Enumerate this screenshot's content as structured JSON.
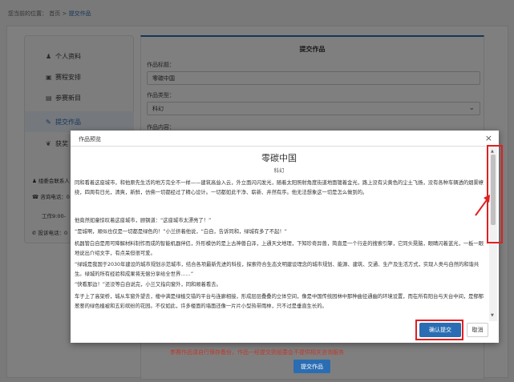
{
  "breadcrumb": {
    "prefix": "您当前的位置：",
    "home": "首页",
    "sep": ">",
    "current": "提交作品"
  },
  "sidebar": {
    "items": [
      {
        "icon": "user-icon",
        "glyph": "♟",
        "label": "个人资料"
      },
      {
        "icon": "calendar-icon",
        "glyph": "▣",
        "label": "赛程安排"
      },
      {
        "icon": "document-icon",
        "glyph": "▤",
        "label": "参赛新目"
      },
      {
        "icon": "edit-icon",
        "glyph": "✎",
        "label": "提交作品"
      },
      {
        "icon": "trophy-icon",
        "glyph": "❦",
        "label": "获奖"
      }
    ],
    "contact": [
      {
        "glyph": "♟",
        "text": "组委会联系人"
      },
      {
        "glyph": "☎",
        "text": "咨询电话：0"
      },
      {
        "glyph": "",
        "text": "工作9:00-"
      },
      {
        "glyph": "✆",
        "text": "投诉电话：0"
      }
    ]
  },
  "form": {
    "title": "提交作品",
    "work_title_label": "作品标题：",
    "work_title_value": "零碳中国",
    "work_type_label": "作品类型：",
    "work_type_value": "科幻",
    "work_content_label": "作品内容："
  },
  "notice": "参赛作品请自行保存备份，作品一经提交则组委会不提供相关咨询服务",
  "submit_button": "提交作品",
  "dialog": {
    "header": "作品预览",
    "close": "×",
    "work_title": "零碳中国",
    "work_genre": "科幻",
    "paragraphs": [
      "同和看着这座城市，和他原先生活的地方完全不一样——建筑高耸入云，外立面闪闪发光，随着太阳照射角度街道地面镀着金光，路上没有尖黄色的尘土飞扬，没有各种车辆透的烟雾缭绕，四周有日光，清爽，新鲜，仿佛一切都经过了精心设计。一切都如此干净、崭新、井然有序。他无法想象这一切是怎么做到的。",
      "他竟然如童惊叹着这座城市，顾钢道：“这座城市太漂亮了！”",
      "“是城啊，顺似也仅是一切都是绿色的！”小兰挤着他说，“白自，告诉同和，绿城有多了不起！”",
      "机器管白自是用可降解材料制作而成的智能机器伴侣，外形模仿的是上古神兽白泽，上通天文地理，下知珍奇异兽，简直是一个行走的搜索引擎，它同头晃脑，眼睛闪着蓝光，一板一眼地说出介绍文字，有点呆但很可爱。",
      "“绿城是我国于2030年建设的城市规划示范城市，结合各项最新先进的科技，探索符合生态文明建设理念的城市规划、能源、建筑、交通、生产及生活方式，实现人类与自然的和谐共生。绿城的所有经验和成果将无偿分享给全世界……”",
      "“快看那边！”还没等白自说完，小兰又指向窗外，同和顺着看去。",
      "车子上了高架桥，城从车窗外望去，楼中满是绿植交错的平台与连廊相接，形成层层叠叠的立体空间，像是中国传统园林中那种曲径通幽的环境设置，而在所有阳台与天台中间，是郁郁葱葱的绿色植被和五彩缤纷的花园。不仅如此，许多楼面的墙面还像一片片小型热带雨林，只不过是垂直生长的。"
    ],
    "confirm_button": "确认提交",
    "cancel_button": "取消"
  },
  "highlight_color": "#e02020",
  "accent_color": "#2a6db3"
}
